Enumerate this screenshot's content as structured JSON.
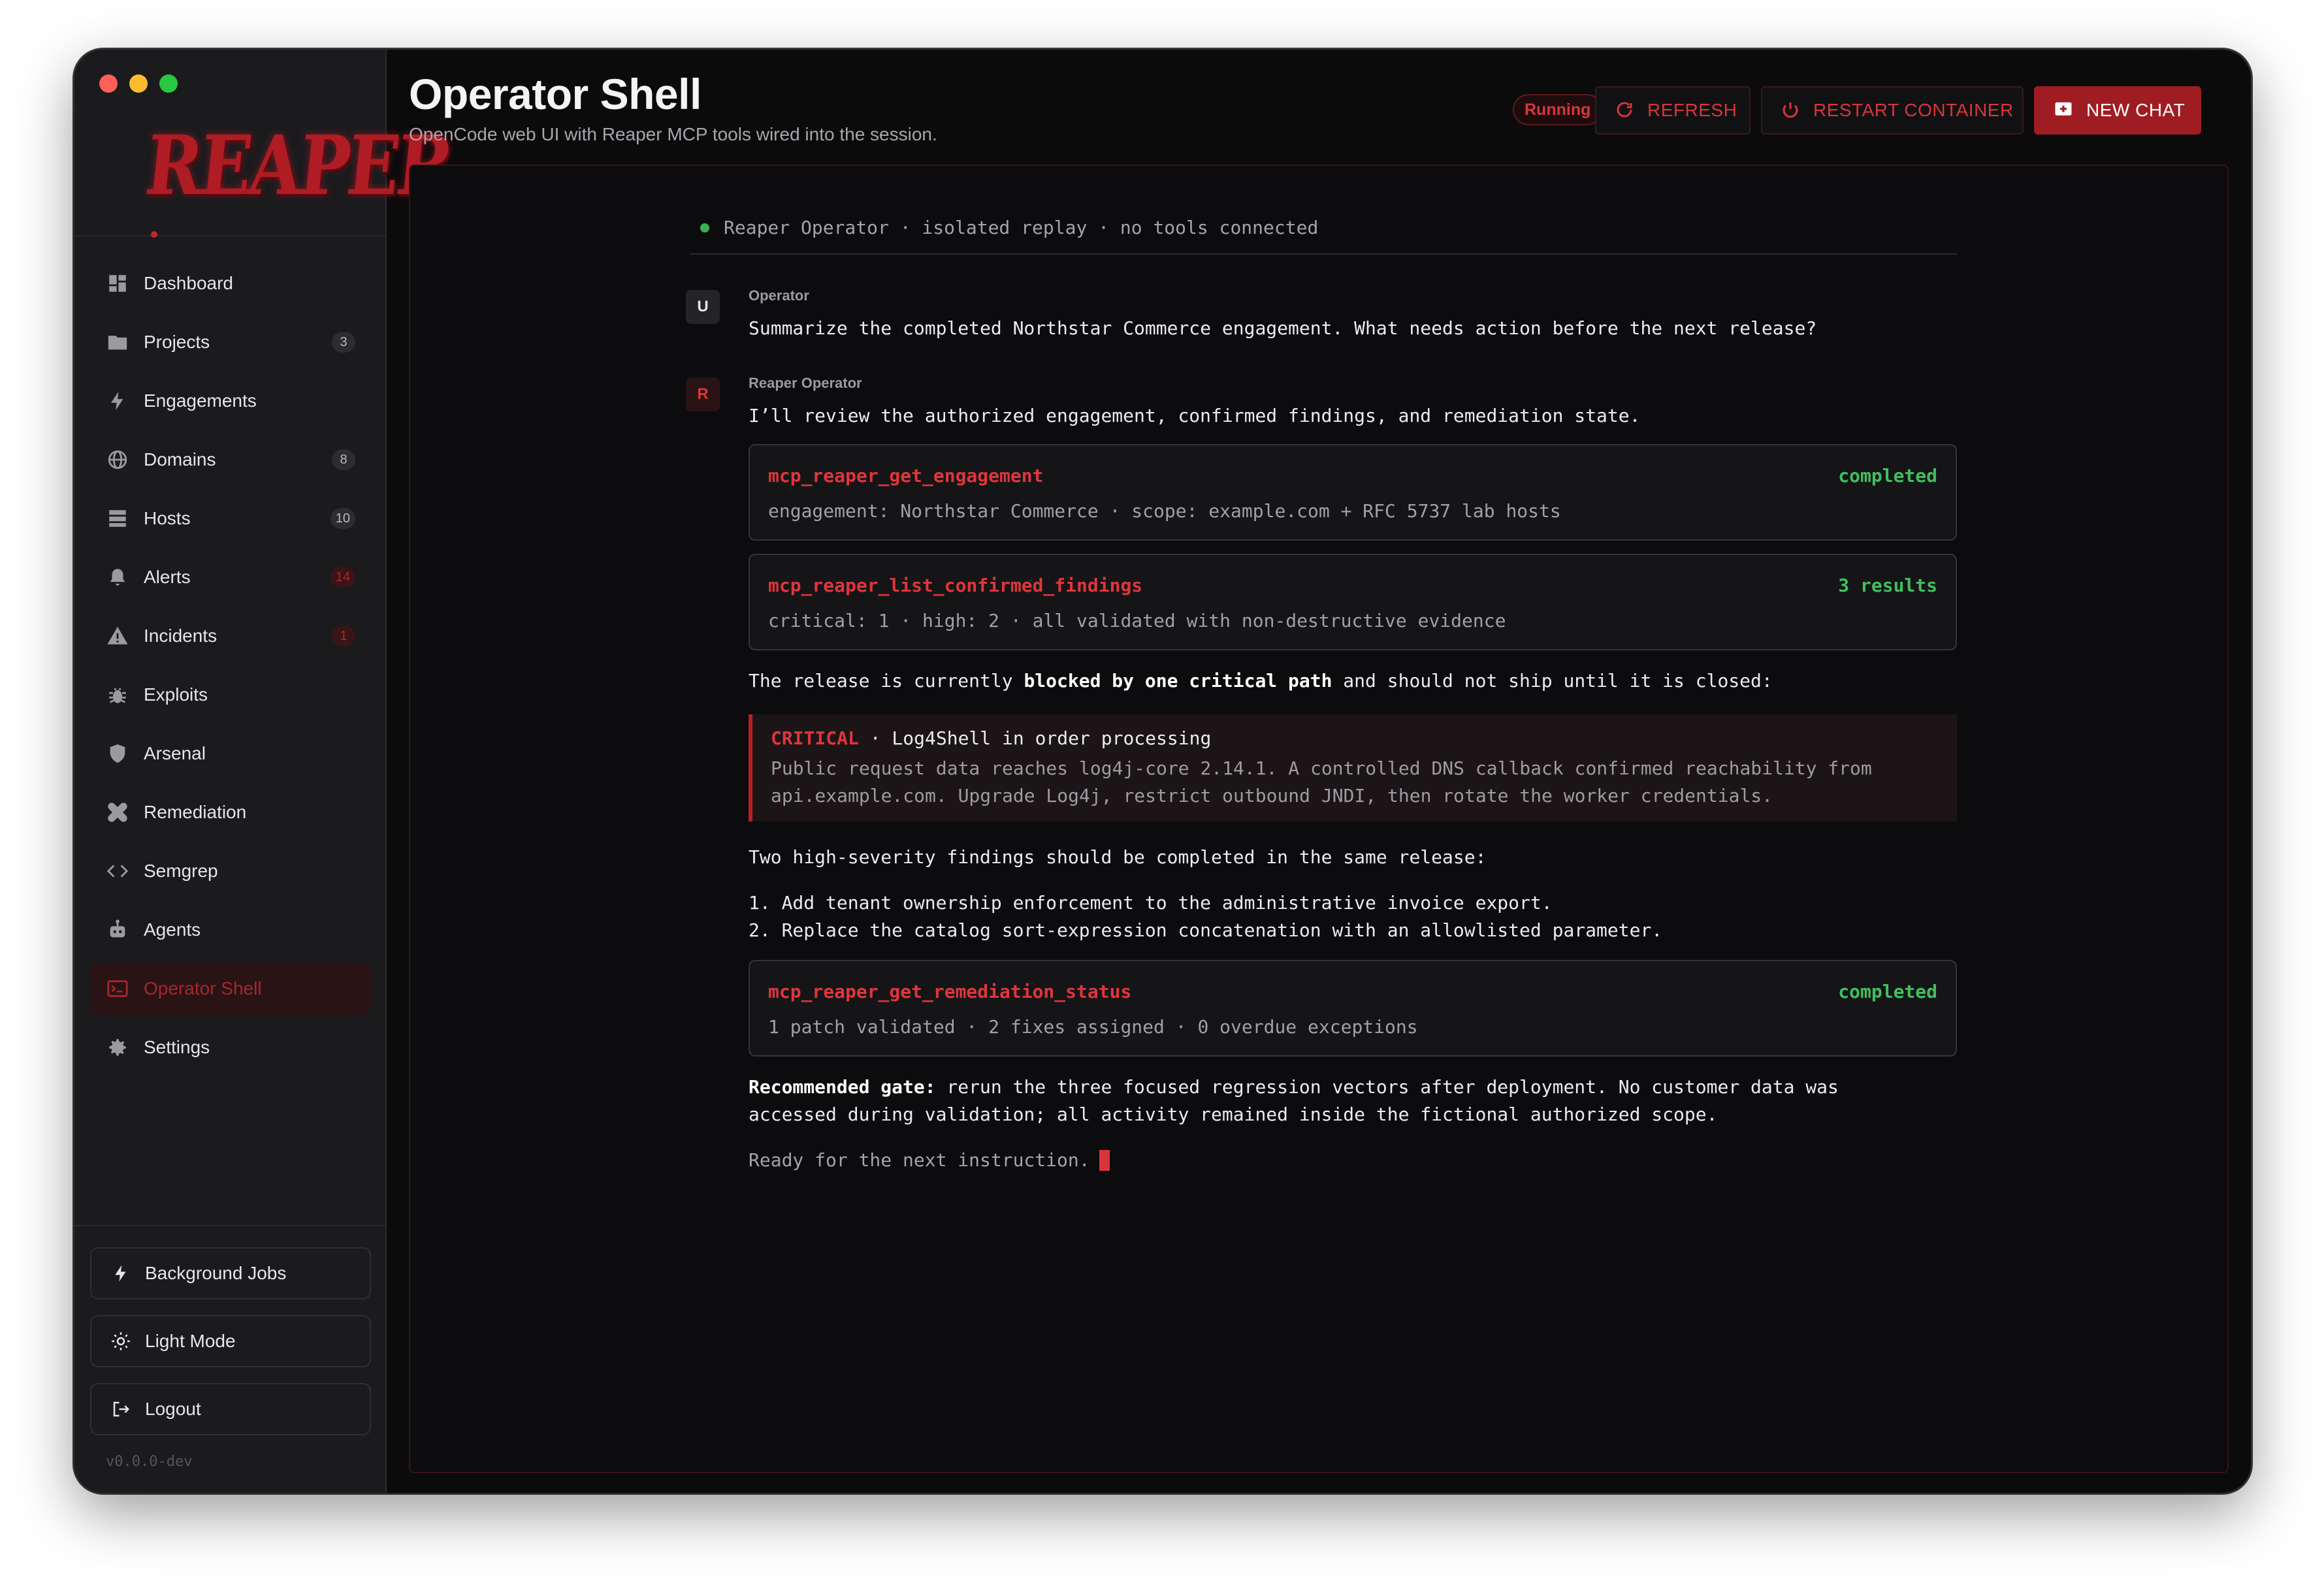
{
  "app": {
    "version": "v0.0.0-dev"
  },
  "sidebar": {
    "logo_text": "REAPER",
    "items": [
      {
        "label": "Dashboard",
        "icon": "dashboard-icon",
        "badge": null
      },
      {
        "label": "Projects",
        "icon": "folder-icon",
        "badge": "3"
      },
      {
        "label": "Engagements",
        "icon": "bolt-icon",
        "badge": null
      },
      {
        "label": "Domains",
        "icon": "globe-icon",
        "badge": "8"
      },
      {
        "label": "Hosts",
        "icon": "server-icon",
        "badge": "10"
      },
      {
        "label": "Alerts",
        "icon": "bell-icon",
        "badge": "14"
      },
      {
        "label": "Incidents",
        "icon": "warning-icon",
        "badge": "1"
      },
      {
        "label": "Exploits",
        "icon": "bug-icon",
        "badge": null
      },
      {
        "label": "Arsenal",
        "icon": "shield-icon",
        "badge": null
      },
      {
        "label": "Remediation",
        "icon": "bandage-icon",
        "badge": null
      },
      {
        "label": "Semgrep",
        "icon": "code-icon",
        "badge": null
      },
      {
        "label": "Agents",
        "icon": "robot-icon",
        "badge": null
      },
      {
        "label": "Operator Shell",
        "icon": "terminal-icon",
        "badge": null,
        "active": true
      },
      {
        "label": "Settings",
        "icon": "gear-icon",
        "badge": null
      }
    ],
    "bottom": {
      "background_jobs": "Background Jobs",
      "light_mode": "Light Mode",
      "logout": "Logout"
    }
  },
  "header": {
    "title": "Operator Shell",
    "subtitle": "OpenCode web UI with Reaper MCP tools wired into the session.",
    "status": "Running",
    "refresh_label": "REFRESH",
    "restart_label": "RESTART CONTAINER",
    "new_chat_label": "NEW CHAT"
  },
  "session": {
    "status_line": "Reaper Operator · isolated replay · no tools connected",
    "user_avatar": "U",
    "user_name": "Operator",
    "user_message": "Summarize the completed Northstar Commerce engagement. What needs action before the next release?",
    "agent_avatar": "R",
    "agent_name": "Reaper Operator",
    "agent_intro": "I’ll review the authorized engagement, confirmed findings, and remediation state.",
    "tool_calls": [
      {
        "name": "mcp_reaper_get_engagement",
        "status": "completed",
        "detail": "engagement: Northstar Commerce · scope: example.com + RFC 5737 lab hosts"
      },
      {
        "name": "mcp_reaper_list_confirmed_findings",
        "status": "3 results",
        "detail": "critical: 1 · high: 2 · all validated with non-destructive evidence"
      },
      {
        "name": "mcp_reaper_get_remediation_status",
        "status": "completed",
        "detail": "1 patch validated · 2 fixes assigned · 0 overdue exceptions"
      }
    ],
    "blocked_pre": "The release is currently ",
    "blocked_bold": "blocked by one critical path",
    "blocked_post": " and should not ship until it is closed:",
    "critical": {
      "severity": "CRITICAL",
      "title": " · Log4Shell in order processing",
      "body_line1": "Public request data reaches log4j-core 2.14.1. A controlled DNS callback confirmed reachability from",
      "body_line2": "api.example.com. Upgrade Log4j, restrict outbound JNDI, then rotate the worker credentials."
    },
    "high_intro": "Two high-severity findings should be completed in the same release:",
    "high_items": [
      "1. Add tenant ownership enforcement to the administrative invoice export.",
      "2. Replace the catalog sort-expression concatenation with an allowlisted parameter."
    ],
    "gate_label": "Recommended gate:",
    "gate_line1": " rerun the three focused regression vectors after deployment. No customer data was",
    "gate_line2": "accessed during validation; all activity remained inside the fictional authorized scope.",
    "ready": "Ready for the next instruction."
  },
  "colors": {
    "accent": "#9f1d22",
    "accent_text": "#d8353b",
    "success": "#3fbf5f",
    "background": "#0b0b0c",
    "sidebar": "#1b1b1e"
  }
}
